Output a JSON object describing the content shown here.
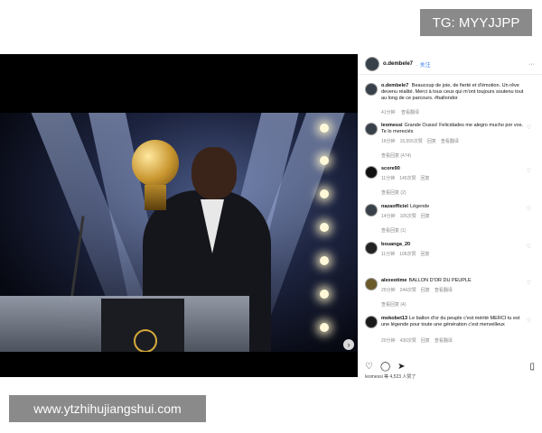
{
  "watermarks": {
    "top": "TG: MYYJJPP",
    "bottom": "www.ytzhihujiangshui.com"
  },
  "post": {
    "username": "o.dembele7",
    "follow_label": "· 关注",
    "more_label": "···",
    "caption_user": "o.dembele7",
    "caption": "Beaucoup de joie, de fierté et d'émotion. Un rêve devenu réalité. Merci à tous ceux qui m'ont toujours soutenu tout au long de ce parcours. #ballondor",
    "caption_meta": [
      "41分钟",
      "查看翻译"
    ]
  },
  "comments": [
    {
      "user": "leomessi",
      "text": "Grande Ousss! Felicidades me alegro mucho por vos. Te lo mereciés",
      "meta": [
        "16分钟",
        "15,555次赞",
        "回复",
        "查看翻译"
      ],
      "replies": "查看回复 (474)"
    },
    {
      "user": "score90",
      "text": "",
      "meta": [
        "11分钟",
        "145次赞",
        "回复"
      ],
      "replies": "查看回复 (2)"
    },
    {
      "user": "nazaofficiel",
      "text": "Légende",
      "meta": [
        "14分钟",
        "105次赞",
        "回复"
      ],
      "replies": "查看回复 (1)"
    },
    {
      "user": "bouanga_20",
      "text": "",
      "meta": [
        "11分钟",
        "106次赞",
        "回复"
      ],
      "replies": ""
    },
    {
      "user": "alexeotime",
      "text": "BALLON D'OR DU PEUPLE",
      "meta": [
        "25分钟",
        "244次赞",
        "回复",
        "查看翻译"
      ],
      "replies": "查看回复 (4)"
    },
    {
      "user": "mokobet13",
      "text": "Le ballon d'or du peuple c'est mérité MERCI tu est une légende pour toute une génération c'est merveilleux",
      "meta": [
        "20分钟",
        "430次赞",
        "回复",
        "查看翻译"
      ],
      "replies": ""
    }
  ],
  "actions": {
    "like_icon": "heart-icon",
    "comment_icon": "comment-icon",
    "share_icon": "send-icon",
    "save_icon": "bookmark-icon",
    "liked_by": "leomessi 等 4,523 人赞了"
  },
  "colors": {
    "accent": "#3b82f6",
    "watermark": "#8a8a8a"
  }
}
